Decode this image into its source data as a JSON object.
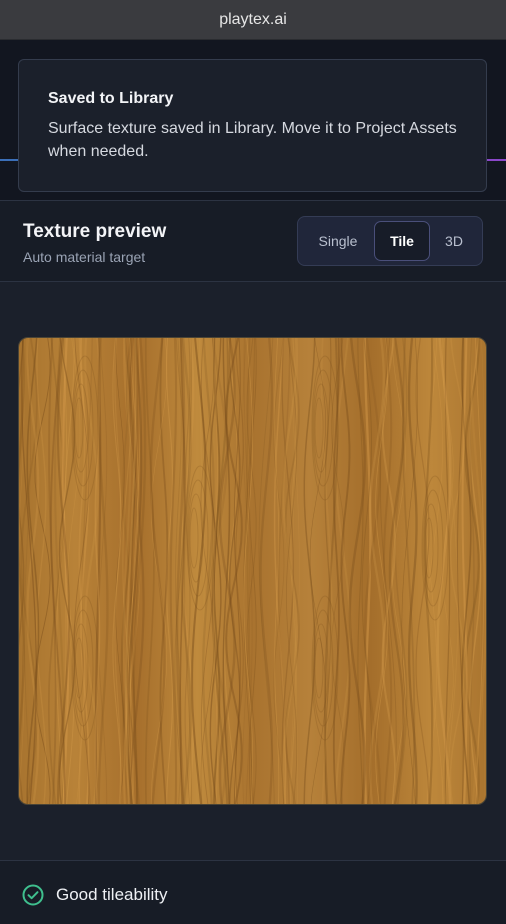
{
  "browser": {
    "url": "playtex.ai"
  },
  "toast": {
    "title": "Saved to Library",
    "message": "Surface texture saved in Library. Move it to Project Assets when needed."
  },
  "preview": {
    "title": "Texture preview",
    "subtitle": "Auto material target",
    "modes": [
      "Single",
      "Tile",
      "3D"
    ],
    "selected_mode": "Tile"
  },
  "texture": {
    "icon": "wood-grain-texture",
    "base_color": "#b07c34"
  },
  "footer": {
    "status": "Good tileability",
    "status_color": "#3fbf8e",
    "icon": "check-circle-icon"
  }
}
